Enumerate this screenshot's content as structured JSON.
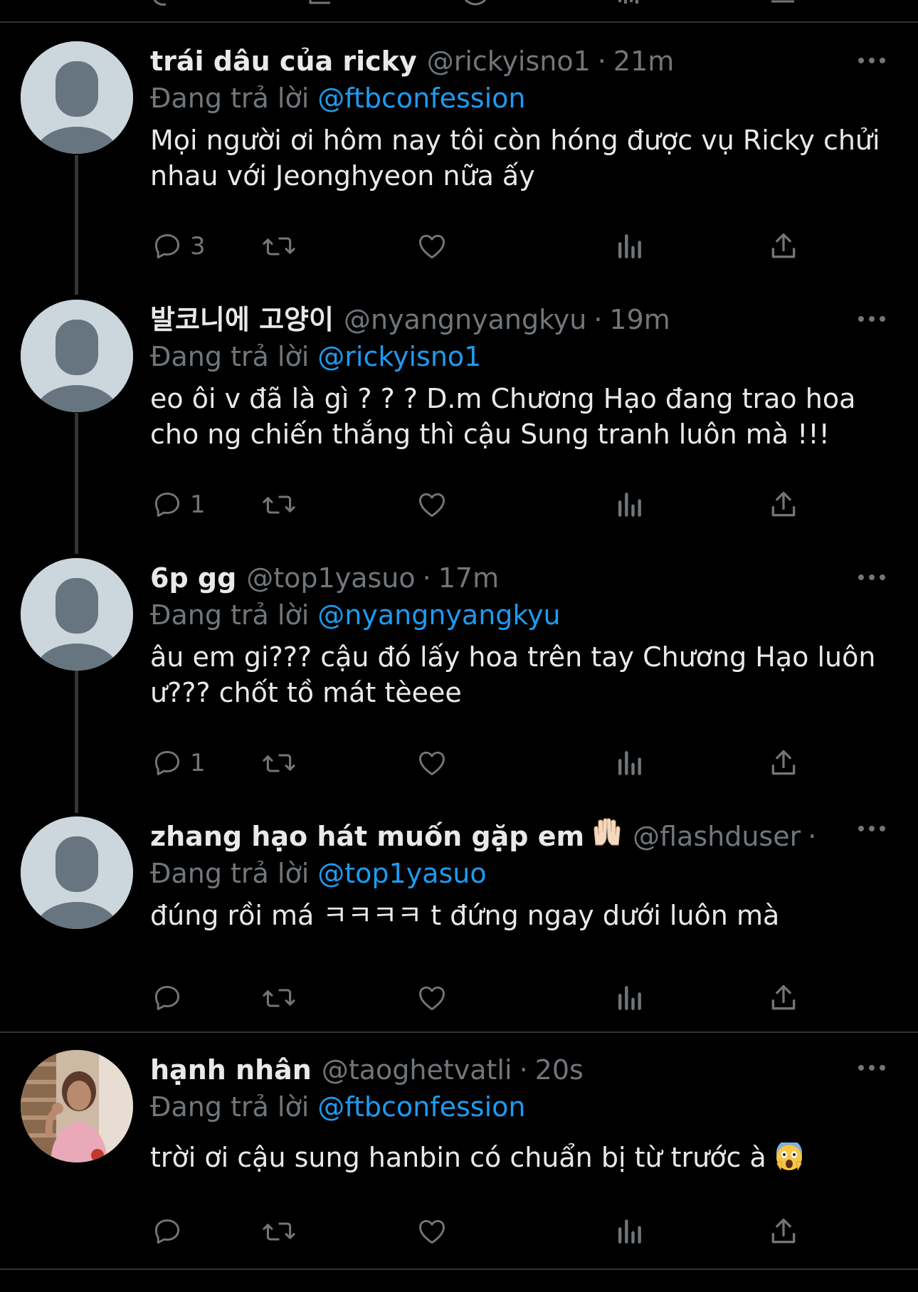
{
  "colors": {
    "background": "#000000",
    "text": "#e7e9ea",
    "secondary": "#71767b",
    "link": "#1d9bf0",
    "divider": "#2f3336",
    "avatar_placeholder_bg": "#ccd6dd",
    "avatar_placeholder_fg": "#66757f"
  },
  "reply_prefix": "Đang trả lời",
  "tweets": [
    {
      "display_name": "trái dâu của ricky",
      "handle": "@rickyisno1",
      "separator": "·",
      "time": "21m",
      "replying_to": "@ftbconfession",
      "text": "Mọi người ơi hôm nay tôi còn hóng được vụ Ricky chửi nhau với Jeonghyeon nữa ấy",
      "reply_count": "3",
      "avatar": "default-avatar-icon"
    },
    {
      "display_name": "발코니에 고양이",
      "handle": "@nyangnyangkyu",
      "separator": "·",
      "time": "19m",
      "replying_to": "@rickyisno1",
      "text": "eo ôi v đã là gì ? ? ? D.m Chương Hạo đang trao hoa cho ng chiến thắng thì cậu Sung tranh luôn mà !!!",
      "reply_count": "1",
      "avatar": "default-avatar-icon"
    },
    {
      "display_name": "6p gg",
      "handle": "@top1yasuo",
      "separator": "·",
      "time": "17m",
      "replying_to": "@nyangnyangkyu",
      "text": "âu em gi??? cậu đó lấy hoa trên tay Chương Hạo luôn ư??? chốt tồ mát tèeee",
      "reply_count": "1",
      "avatar": "default-avatar-icon"
    },
    {
      "display_name": "zhang hạo hát muốn gặp em",
      "name_emoji": "raised-hands-emoji",
      "handle": "@flashduser",
      "separator": "·",
      "time": "…",
      "replying_to": "@top1yasuo",
      "text": "đúng rồi má ㅋㅋㅋㅋ t đứng ngay dưới luôn mà",
      "reply_count": "",
      "avatar": "default-avatar-icon"
    },
    {
      "display_name": "hạnh nhân",
      "handle": "@taoghetvatli",
      "separator": "·",
      "time": "20s",
      "replying_to": "@ftbconfession",
      "text": "trời ơi cậu sung hanbin có chuẩn bị từ trước à",
      "text_emoji": "screaming-face-emoji",
      "reply_count": "",
      "avatar": "photo-avatar"
    }
  ],
  "icons": {
    "reply": "reply-icon",
    "retweet": "retweet-icon",
    "like": "heart-icon",
    "views": "views-icon",
    "share": "share-icon",
    "more": "more-icon"
  }
}
